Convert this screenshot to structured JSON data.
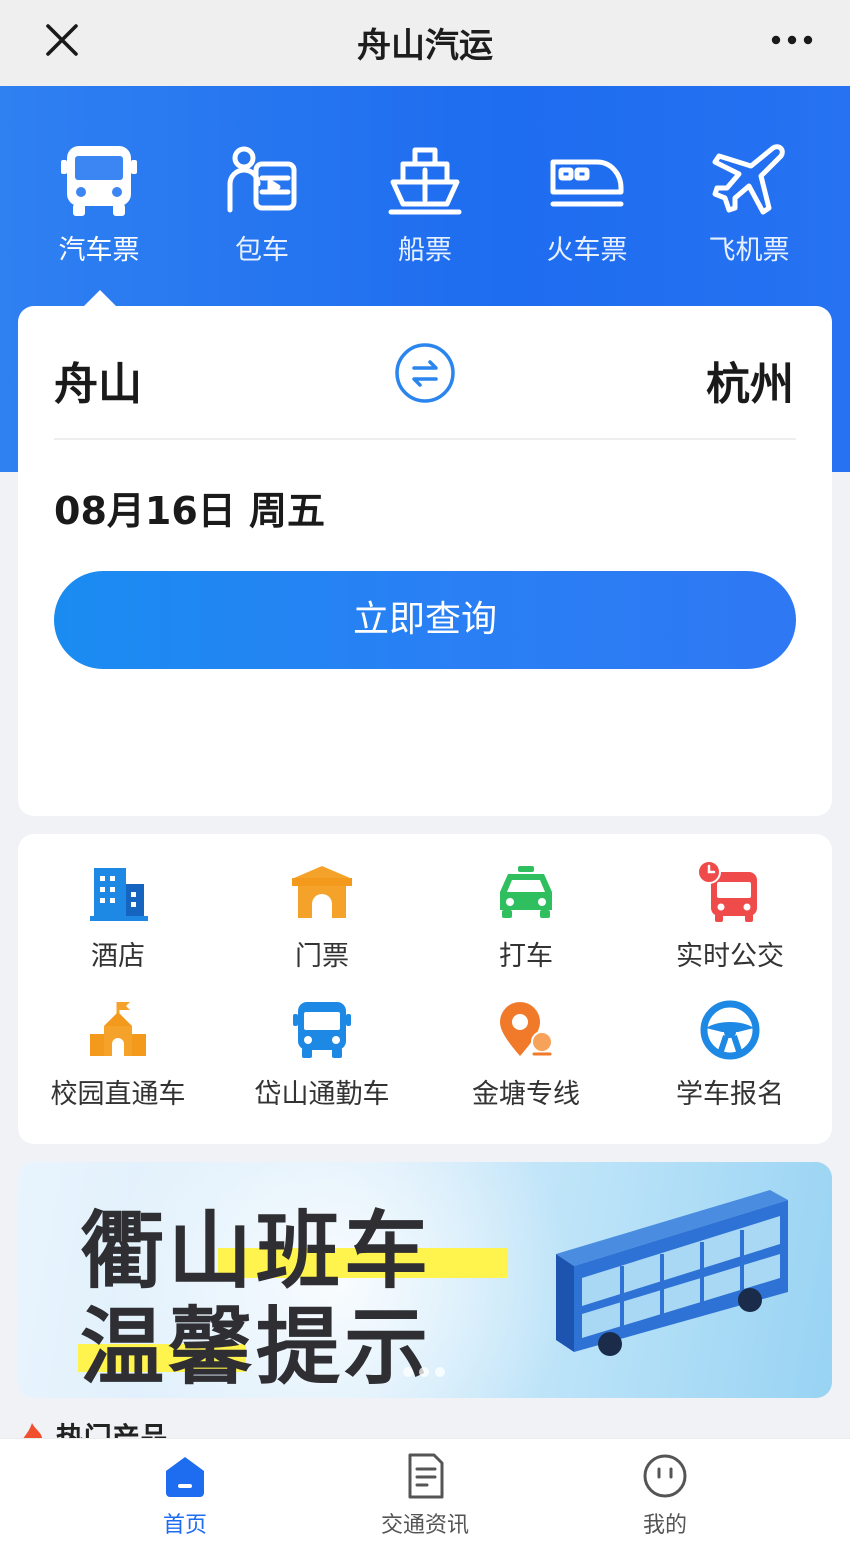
{
  "header": {
    "title": "舟山汽运"
  },
  "modes": [
    {
      "label": "汽车票",
      "icon": "bus-icon",
      "active": true
    },
    {
      "label": "包车",
      "icon": "charter-car-icon"
    },
    {
      "label": "船票",
      "icon": "ship-icon"
    },
    {
      "label": "火车票",
      "icon": "train-icon"
    },
    {
      "label": "飞机票",
      "icon": "plane-icon"
    }
  ],
  "search": {
    "from": "舟山",
    "to": "杭州",
    "date": "08月16日 周五",
    "button": "立即查询"
  },
  "services": [
    {
      "label": "酒店",
      "icon": "hotel-icon",
      "color": "#1e88e5"
    },
    {
      "label": "门票",
      "icon": "ticket-gate-icon",
      "color": "#f5a22a"
    },
    {
      "label": "打车",
      "icon": "taxi-icon",
      "color": "#2fbf5f"
    },
    {
      "label": "实时公交",
      "icon": "realtime-bus-icon",
      "color": "#ef4b4b"
    },
    {
      "label": "校园直通车",
      "icon": "school-icon",
      "color": "#f5a22a"
    },
    {
      "label": "岱山通勤车",
      "icon": "commute-bus-icon",
      "color": "#1e88e5"
    },
    {
      "label": "金塘专线",
      "icon": "location-icon",
      "color": "#f07a2a"
    },
    {
      "label": "学车报名",
      "icon": "steering-wheel-icon",
      "color": "#1e88e5"
    }
  ],
  "banner": {
    "line1": "衢山班车",
    "line2": "温馨提示"
  },
  "hot": {
    "title": "热门产品"
  },
  "tabs": [
    {
      "label": "首页",
      "icon": "home-icon",
      "active": true
    },
    {
      "label": "交通资讯",
      "icon": "news-icon"
    },
    {
      "label": "我的",
      "icon": "profile-icon"
    }
  ],
  "colors": {
    "primary": "#1e6cf0",
    "accent": "#2a7ff4"
  }
}
